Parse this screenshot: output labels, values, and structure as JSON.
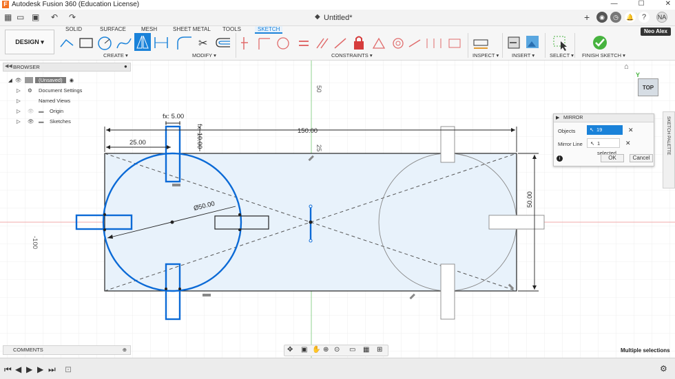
{
  "app": {
    "title": "Autodesk Fusion 360 (Education License)",
    "logo": "F"
  },
  "document": {
    "tab_title": "Untitled*"
  },
  "user": {
    "initials": "NA",
    "profile": "Neo Alex"
  },
  "workspace": {
    "label": "DESIGN ▾"
  },
  "ribbon": {
    "tabs": [
      "SOLID",
      "SURFACE",
      "MESH",
      "SHEET METAL",
      "TOOLS",
      "SKETCH"
    ],
    "active_tab": "SKETCH",
    "groups": [
      "CREATE ▾",
      "MODIFY ▾",
      "CONSTRAINTS ▾",
      "INSPECT ▾",
      "INSERT ▾",
      "SELECT ▾",
      "FINISH SKETCH ▾"
    ]
  },
  "browser": {
    "title": "BROWSER",
    "root": "(Unsaved)",
    "items": [
      "Document Settings",
      "Named Views",
      "Origin",
      "Sketches"
    ]
  },
  "mirror": {
    "title": "MIRROR",
    "objects_label": "Objects",
    "objects_value": "19 selected",
    "line_label": "Mirror Line",
    "line_value": "1 selected",
    "ok": "OK",
    "cancel": "Cancel"
  },
  "sketch_palette": {
    "label": "SKETCH PALETTE"
  },
  "viewcube": {
    "face": "TOP"
  },
  "dimensions": {
    "overall_width": "150.00",
    "offset_left": "25.00",
    "height": "50.00",
    "diameter": "Ø50.00",
    "fx_width": "fx: 5.00",
    "fx_depth": "fx: 10.00",
    "axis_top": "50",
    "axis_mid": "25",
    "axis_left": "-100"
  },
  "comments": {
    "label": "COMMENTS"
  },
  "status": {
    "text": "Multiple selections"
  },
  "colors": {
    "accent": "#1a82d9",
    "selection": "#0b6ad6",
    "finish_check": "#47b33f"
  }
}
